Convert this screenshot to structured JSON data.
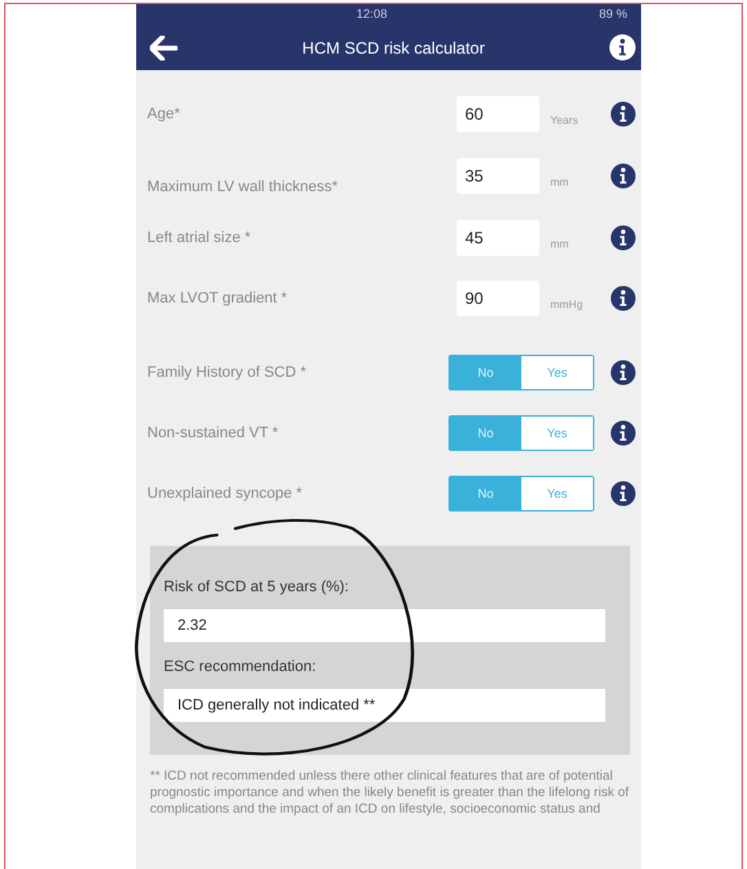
{
  "status_bar": {
    "time": "12:08",
    "battery": "89 %"
  },
  "header": {
    "title": "HCM SCD risk calculator"
  },
  "fields": [
    {
      "kind": "number",
      "label": "Age*",
      "value": "60",
      "unit": "Years"
    },
    {
      "kind": "number",
      "label": "Maximum LV wall thickness*",
      "value": "35",
      "unit": "mm"
    },
    {
      "kind": "number",
      "label": "Left atrial size *",
      "value": "45",
      "unit": "mm"
    },
    {
      "kind": "number",
      "label": "Max LVOT gradient *",
      "value": "90",
      "unit": "mmHg"
    },
    {
      "kind": "toggle",
      "label": "Family History of SCD *",
      "options": [
        {
          "label": "No",
          "selected": true
        },
        {
          "label": "Yes",
          "selected": false
        }
      ]
    },
    {
      "kind": "toggle",
      "label": "Non-sustained VT *",
      "options": [
        {
          "label": "No",
          "selected": true
        },
        {
          "label": "Yes",
          "selected": false
        }
      ]
    },
    {
      "kind": "toggle",
      "label": "Unexplained syncope *",
      "options": [
        {
          "label": "No",
          "selected": true
        },
        {
          "label": "Yes",
          "selected": false
        }
      ]
    }
  ],
  "results": [
    {
      "label": "Risk of SCD at 5 years (%):",
      "value": "2.32"
    },
    {
      "label": "ESC recommendation:",
      "value": "ICD generally not indicated **"
    }
  ],
  "footnote": "** ICD not recommended unless there other clinical features that are of potential prognostic importance and when the likely benefit is greater than the lifelong risk of complications and the impact of an ICD on lifestyle, socioeconomic status and"
}
